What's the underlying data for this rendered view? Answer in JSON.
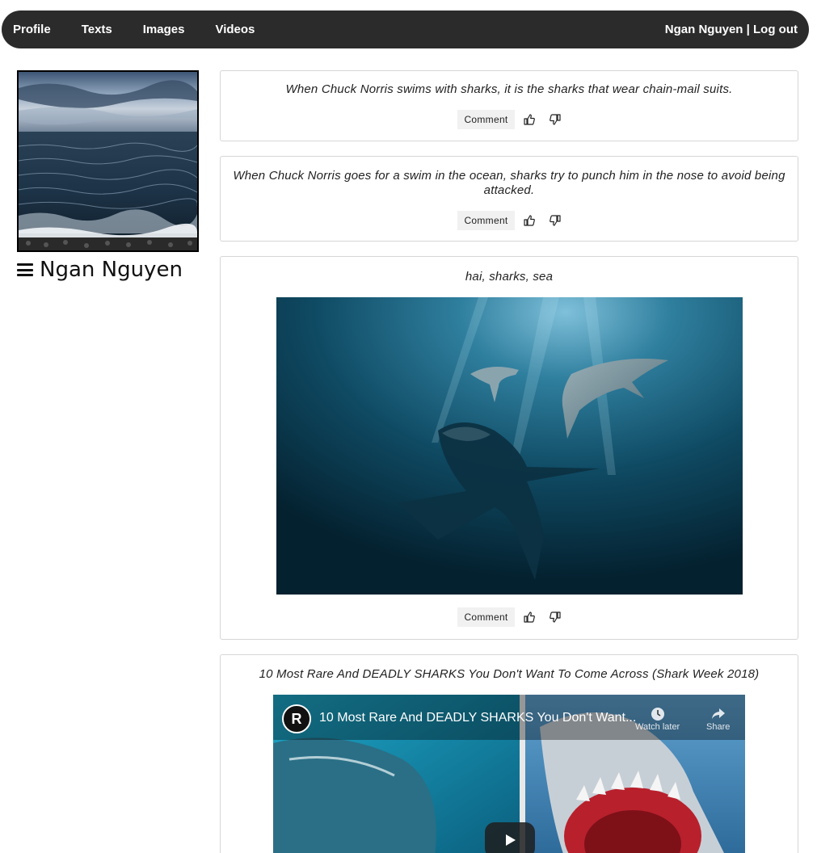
{
  "nav": {
    "items": [
      "Profile",
      "Texts",
      "Images",
      "Videos"
    ],
    "user_name": "Ngan Nguyen",
    "separator": " | ",
    "logout": "Log out"
  },
  "sidebar": {
    "name": "Ngan Nguyen",
    "menu_icon": "hamburger-icon",
    "photo": "sea-photo"
  },
  "posts": [
    {
      "text": "When Chuck Norris swims with sharks, it is the sharks that wear chain-mail suits.",
      "comment_label": "Comment"
    },
    {
      "text": "When Chuck Norris goes for a swim in the ocean, sharks try to punch him in the nose to avoid being attacked.",
      "comment_label": "Comment"
    },
    {
      "text": "hai, sharks, sea",
      "comment_label": "Comment",
      "image": "sharks-underwater-image"
    },
    {
      "text": "10 Most Rare And DEADLY SHARKS You Don't Want To Come Across (Shark Week 2018)",
      "video": {
        "title": "10 Most Rare And DEADLY SHARKS You Don't Want...",
        "watch_later": "Watch later",
        "share": "Share"
      }
    }
  ],
  "icons": {
    "like": "thumbs-up-icon",
    "dislike": "thumbs-down-icon"
  }
}
